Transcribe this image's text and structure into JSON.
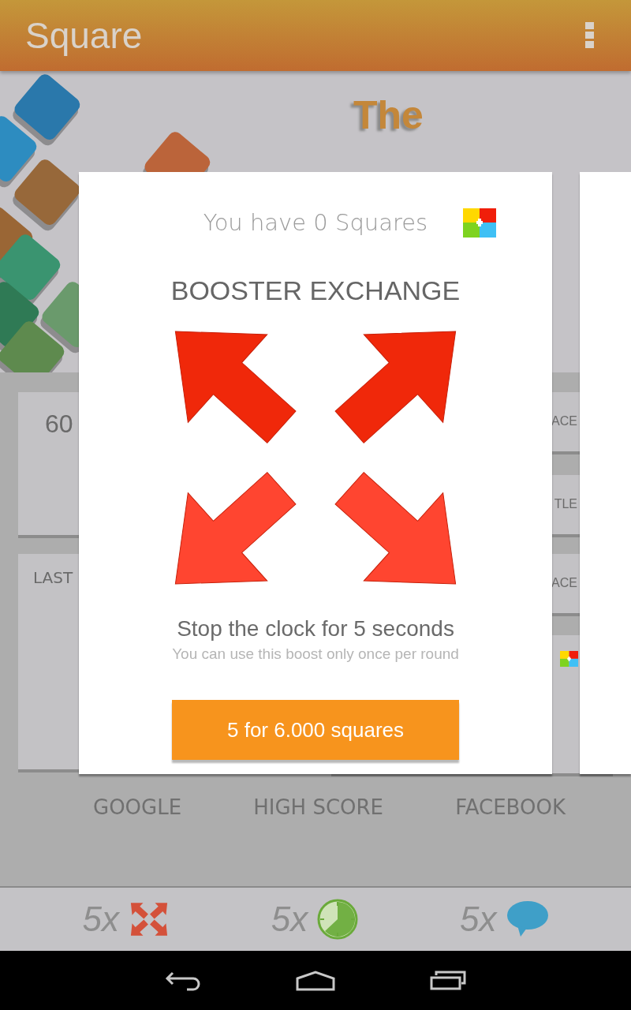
{
  "app_bar": {
    "title": "Square"
  },
  "banner": {
    "logo_lines": [
      "The"
    ]
  },
  "left_cards": [
    {
      "kind": "score",
      "text": "60"
    },
    {
      "kind": "label",
      "text": "LAST"
    }
  ],
  "right_cards": [
    {
      "kind": "text",
      "text": "ACE"
    },
    {
      "kind": "text",
      "text": "TLE"
    },
    {
      "kind": "text",
      "text": "ACE"
    },
    {
      "kind": "logo"
    }
  ],
  "links": [
    "GOOGLE",
    "HIGH SCORE",
    "FACEBOOK"
  ],
  "boosters": [
    {
      "count": "5x",
      "kind": "expand"
    },
    {
      "count": "5x",
      "kind": "clock"
    },
    {
      "count": "5x",
      "kind": "chat"
    }
  ],
  "dialog": {
    "balance": "You have 0 Squares",
    "title": "BOOSTER EXCHANGE",
    "headline": "Stop the clock for 5 seconds",
    "note": "You can use this boost only once per round",
    "button": "5 for 6.000 squares"
  }
}
